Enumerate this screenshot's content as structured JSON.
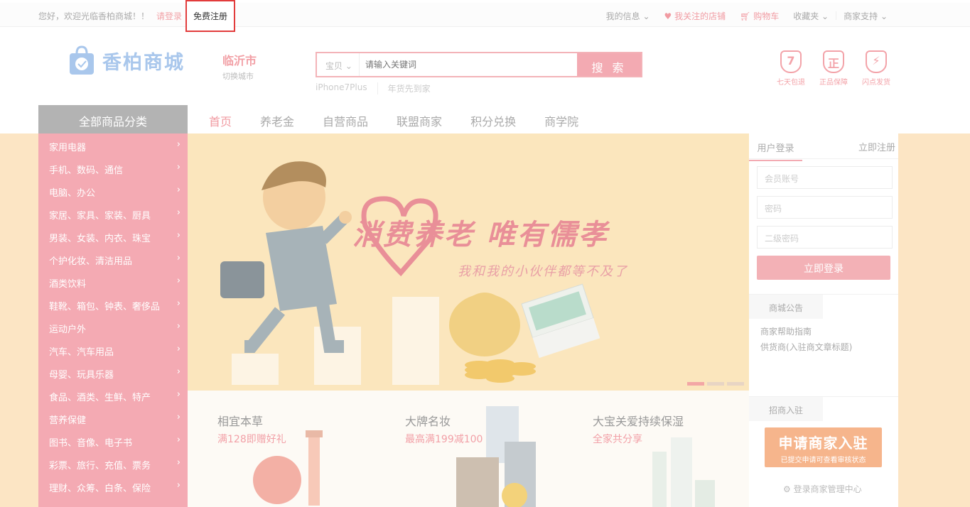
{
  "topbar": {
    "welcome": "您好，欢迎光临香柏商城！！",
    "login": "请登录",
    "register": "免费注册",
    "my_info": "我的信息",
    "followed_shops": "我关注的店铺",
    "cart": "购物车",
    "favorites": "收藏夹",
    "merchant_support": "商家支持"
  },
  "header": {
    "logo_text": "香柏商城",
    "city": "临沂市",
    "switch_city": "切换城市",
    "search_type": "宝贝",
    "search_placeholder": "请输入关键词",
    "search_button": "搜 索",
    "hot_words": [
      "iPhone7Plus",
      "年货先到家"
    ],
    "badges": [
      {
        "glyph": "7",
        "label": "七天包退"
      },
      {
        "glyph": "正",
        "label": "正品保障"
      },
      {
        "glyph": "⚡",
        "label": "闪点发货"
      }
    ]
  },
  "nav": {
    "category_title": "全部商品分类",
    "items": [
      "首页",
      "养老金",
      "自营商品",
      "联盟商家",
      "积分兑换",
      "商学院"
    ]
  },
  "categories": [
    "家用电器",
    "手机、数码、通信",
    "电脑、办公",
    "家居、家具、家装、厨具",
    "男装、女装、内衣、珠宝",
    "个护化妆、清洁用品",
    "酒类饮料",
    "鞋靴、箱包、钟表、奢侈品",
    "运动户外",
    "汽车、汽车用品",
    "母婴、玩具乐器",
    "食品、酒类、生鲜、特产",
    "营养保健",
    "图书、音像、电子书",
    "彩票、旅行、充值、票务",
    "理财、众筹、白条、保险"
  ],
  "banner": {
    "slogan": "消费养老 唯有儒孝",
    "subtitle": "我和我的小伙伴都等不及了"
  },
  "promos": [
    {
      "title": "相宜本草",
      "subtitle": "满128即赠好礼"
    },
    {
      "title": "大牌名妆",
      "subtitle": "最高满199减100"
    },
    {
      "title": "大宝关爱持续保湿",
      "subtitle": "全家共分享"
    }
  ],
  "login_panel": {
    "tab_login": "用户登录",
    "tab_register": "立即注册",
    "account_placeholder": "会员账号",
    "password_placeholder": "密码",
    "second_password_placeholder": "二级密码",
    "login_button": "立即登录",
    "notice_title": "商城公告",
    "notices": [
      "商家帮助指南",
      "供货商(入驻商文章标题)"
    ],
    "merchant_title": "招商入驻",
    "apply_title": "申请商家入驻",
    "apply_sub": "已提交申请可查看审核状态",
    "merchant_center": "登录商家管理中心"
  },
  "colors": {
    "accent_pink": "#f3aab2",
    "band": "#fce5c4",
    "logo_blue": "#a9c7ec"
  }
}
